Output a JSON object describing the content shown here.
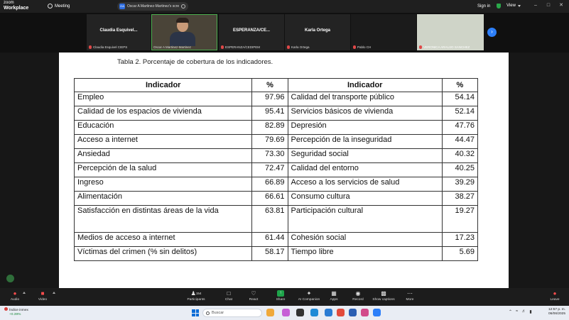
{
  "titlebar": {
    "logo_line1": "zoom",
    "logo_line2": "Workplace",
    "meeting_label": "Meeting",
    "share_badge": "OA",
    "share_text": "Oscar A Martinez-Martinez's scre",
    "signin": "Sign in",
    "view": "View"
  },
  "gallery": {
    "tiles": [
      {
        "name": "Claudia Esquivel...",
        "label": "Claudia Esquivel CIEPS"
      },
      {
        "name": "",
        "label": "Oscar A Martinez-Martinez"
      },
      {
        "name": "ESPERANZA/CE...",
        "label": "ESPERANZA/CEDIPEM"
      },
      {
        "name": "Karla Ortega",
        "label": "Karla Ortega"
      },
      {
        "name": "",
        "label": "Pablo CH"
      },
      {
        "name": "",
        "label": "VERONICA ARAUJO SANCHEZ"
      }
    ]
  },
  "slide": {
    "caption": "Tabla 2. Porcentaje de cobertura de los indicadores.",
    "headers": [
      "Indicador",
      "%",
      "Indicador",
      "%"
    ],
    "rows": [
      [
        "Empleo",
        "97.96",
        "Calidad del transporte público",
        "54.14"
      ],
      [
        "Calidad de los espacios de vivienda",
        "95.41",
        "Servicios básicos de vivienda",
        "52.14"
      ],
      [
        "Educación",
        "82.89",
        "Depresión",
        "47.76"
      ],
      [
        "Acceso a internet",
        "79.69",
        "Percepción de la inseguridad",
        "44.47"
      ],
      [
        "Ansiedad",
        "73.30",
        "Seguridad social",
        "40.32"
      ],
      [
        "Percepción de la salud",
        "72.47",
        "Calidad del entorno",
        "40.25"
      ],
      [
        "Ingreso",
        "66.89",
        "Acceso a los servicios de salud",
        "39.29"
      ],
      [
        "Alimentación",
        "66.61",
        "Consumo cultura",
        "38.27"
      ],
      [
        "Satisfacción en distintas áreas de la vida",
        "63.81",
        "Participación cultural",
        "19.27"
      ],
      [
        "Medios de acceso a internet",
        "61.44",
        "Cohesión social",
        "17.23"
      ],
      [
        "Víctimas del crimen (% sin delitos)",
        "58.17",
        "Tiempo libre",
        "5.69"
      ]
    ]
  },
  "controls": {
    "audio": "Audio",
    "video": "Video",
    "participants": "Participants",
    "participants_count": "154",
    "chat": "Chat",
    "react": "React",
    "share": "Share",
    "ai_companion": "AI Companion",
    "apps": "Apps",
    "record": "Record",
    "captions": "Show captions",
    "more": "More",
    "leave": "Leave"
  },
  "taskbar": {
    "weather_title": "Índice inmex",
    "weather_change": "+0.39%",
    "search_placeholder": "Buscar",
    "time": "12:57 p. m.",
    "date": "06/06/2025"
  },
  "colors": {
    "share_green": "#1ea34a",
    "leave_red": "#ff4d4d",
    "accent_blue": "#2d7ff9"
  }
}
